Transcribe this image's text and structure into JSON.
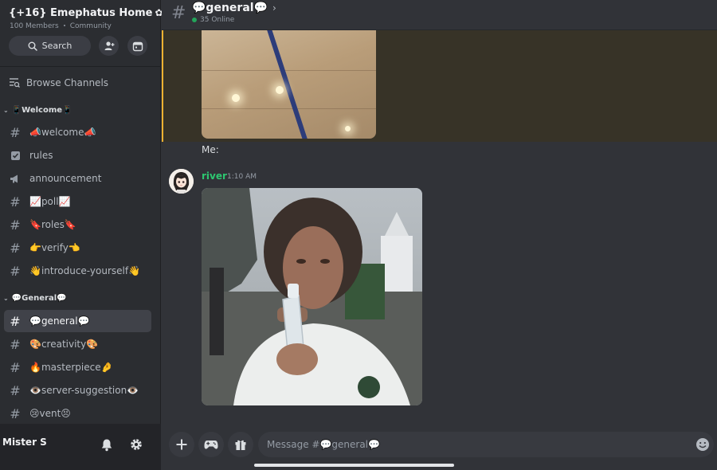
{
  "server": {
    "name": "{+16} Emephatus Home",
    "members": "100 Members",
    "type": "Community"
  },
  "sidebar": {
    "search_label": "Search",
    "browse_label": "Browse Channels",
    "categories": [
      {
        "label": "📱Welcome📱"
      },
      {
        "label": "💬General💬"
      }
    ],
    "channels": [
      {
        "label": "📣welcome📣",
        "icon": "hash-icon"
      },
      {
        "label": "rules",
        "icon": "rules-icon"
      },
      {
        "label": "announcement",
        "icon": "megaphone-icon"
      },
      {
        "label": "📈poll📈",
        "icon": "hash-icon"
      },
      {
        "label": "🔖roles🔖",
        "icon": "hash-icon"
      },
      {
        "label": "👉verify👈",
        "icon": "hash-icon"
      },
      {
        "label": "👋introduce-yourself👋",
        "icon": "thread-hash-icon"
      },
      {
        "label": "💬general💬",
        "icon": "hash-icon",
        "active": true
      },
      {
        "label": "🎨creativity🎨",
        "icon": "thread-hash-icon"
      },
      {
        "label": "🔥masterpiece🤌",
        "icon": "thread-hash-icon"
      },
      {
        "label": "👁️server-suggestion👁️",
        "icon": "thread-hash-icon"
      },
      {
        "label": "😢vent😣",
        "icon": "thread-hash-icon"
      }
    ]
  },
  "user": {
    "name": "Mister S"
  },
  "channel_header": {
    "title": "💬general💬",
    "online": "35 Online"
  },
  "messages": [
    {
      "text": "Me:"
    },
    {
      "author": "river",
      "time": "1:10 AM"
    }
  ],
  "composer": {
    "placeholder": "Message #💬general💬"
  },
  "colors": {
    "accent_green": "#2dc770",
    "mention_highlight": "#f0b232",
    "sidebar_bg": "#2b2d31",
    "chat_bg": "#313338"
  }
}
